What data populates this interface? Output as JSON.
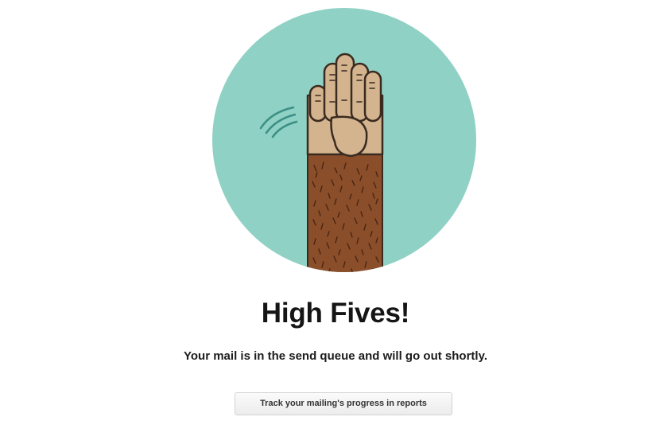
{
  "confirmation": {
    "headline": "High Fives!",
    "message": "Your mail is in the send queue and will go out shortly.",
    "reports_button_label": "Track your mailing's progress in reports"
  },
  "illustration": {
    "icon": "high-five-hand-icon",
    "circle_color": "#8fd1c4",
    "skin_color": "#d3b48e",
    "fur_color": "#8a4f2a",
    "outline_color": "#3a2a20",
    "motion_lines_color": "#3b8f84"
  }
}
